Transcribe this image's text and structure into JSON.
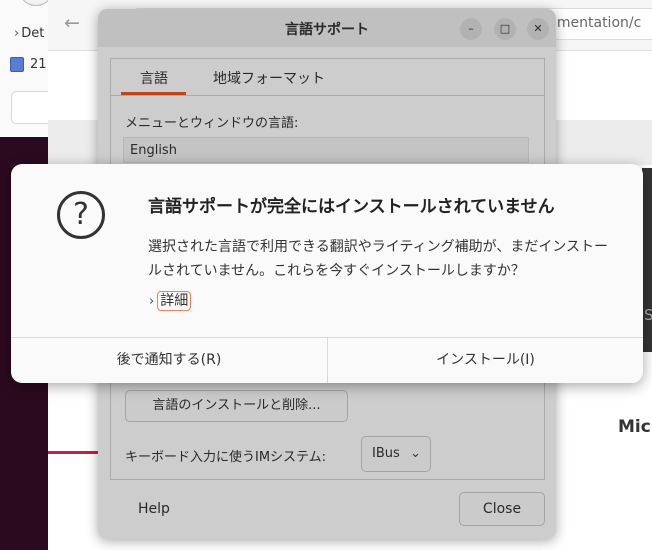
{
  "background": {
    "sidebar_item_1": "Det",
    "sidebar_item_2": "21",
    "url_fragment": "umentation/c",
    "right_fragment_s": "S",
    "right_fragment_micr": "Micr"
  },
  "language_support": {
    "title": "言語サポート",
    "tabs": [
      "言語",
      "地域フォーマット"
    ],
    "menu_language_label": "メニューとウィンドウの言語:",
    "selected_language": "English",
    "install_remove_button": "言語のインストールと削除...",
    "im_system_label": "キーボード入力に使うIMシステム:",
    "im_system_value": "IBus",
    "help_button": "Help",
    "close_button": "Close"
  },
  "dialog": {
    "title": "言語サポートが完全にはインストールされていません",
    "body": "選択された言語で利用できる翻訳やライティング補助が、まだインストールされていません。これらを今すぐインストールしますか？",
    "details_label": "詳細",
    "remind_later_button": "後で通知する(R)",
    "install_button": "インストール(I)"
  }
}
